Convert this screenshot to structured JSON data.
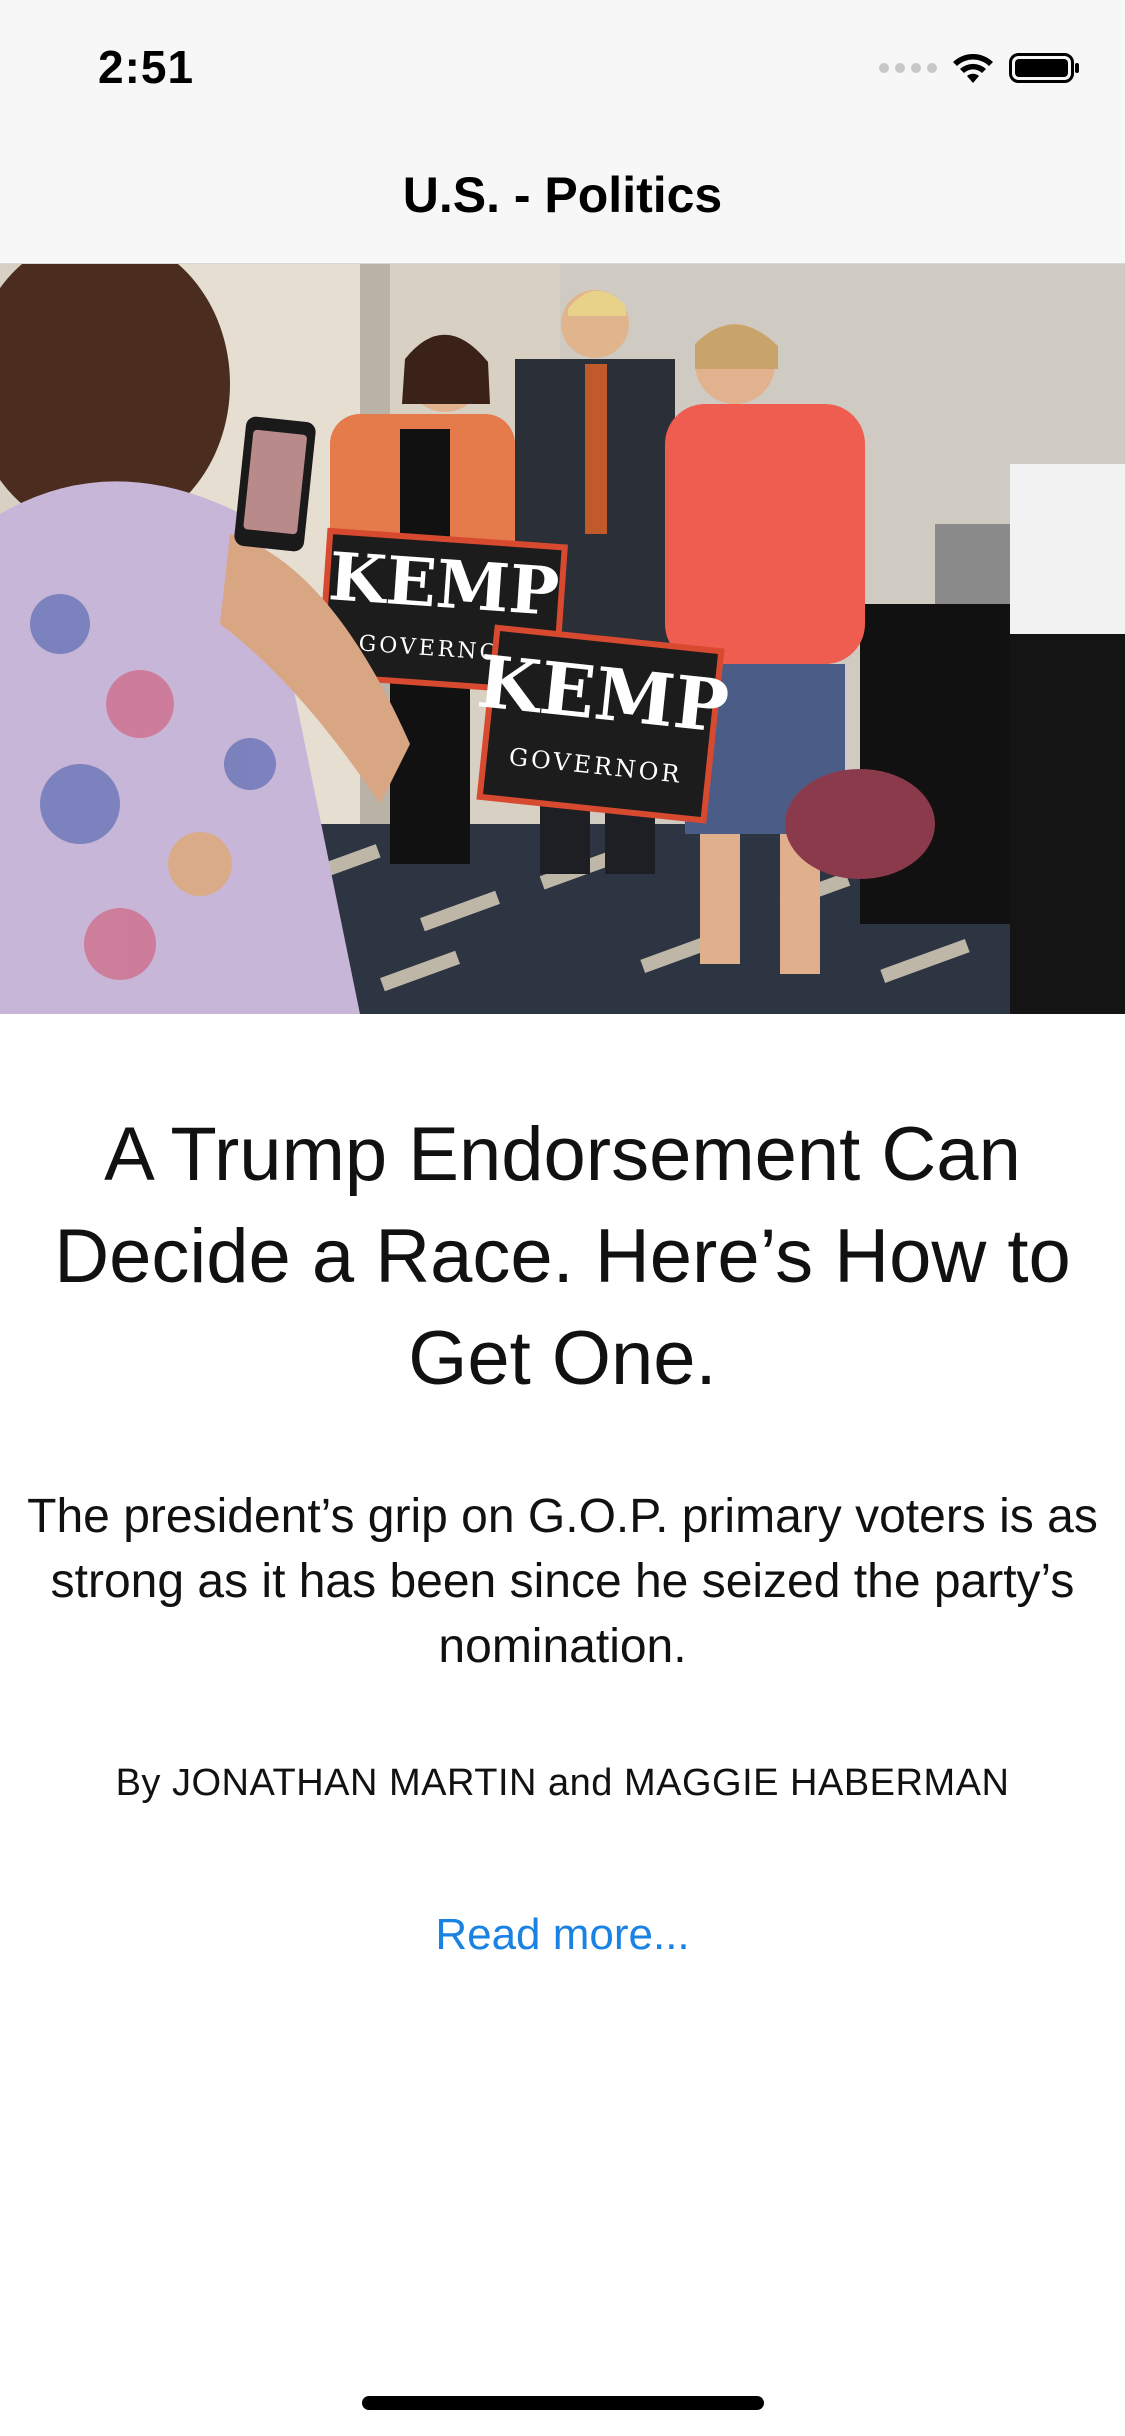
{
  "status_bar": {
    "time": "2:51",
    "icons": [
      "cellular-signal-icon",
      "wifi-icon",
      "battery-icon"
    ]
  },
  "nav": {
    "title": "U.S. - Politics"
  },
  "hero_image": {
    "sign_text_1": "KEMP",
    "sign_subtext_1": "GOVERNOR",
    "sign_text_2": "KEMP",
    "sign_subtext_2": "GOVERNOR"
  },
  "article": {
    "headline": "A Trump Endorsement Can Decide a Race. Here’s How to Get One.",
    "summary": "The president’s grip on G.O.P. primary voters is as strong as it has been since he seized the party’s nomination.",
    "byline": "By JONATHAN MARTIN and MAGGIE HABERMAN",
    "read_more": "Read more..."
  },
  "colors": {
    "link": "#1a82e2",
    "bar_background": "#f7f7f7"
  }
}
